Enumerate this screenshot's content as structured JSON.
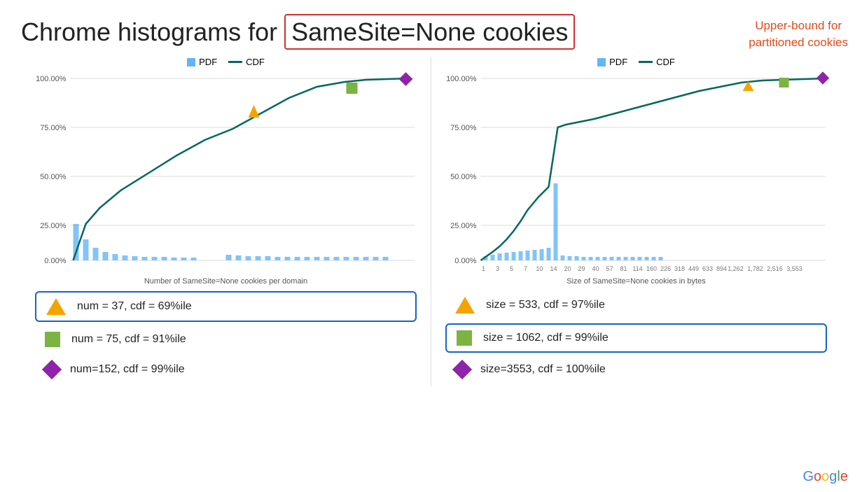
{
  "page": {
    "title_prefix": "Chrome histograms for ",
    "title_highlight": "SameSite=None cookies",
    "upper_bound_line1": "Upper-bound for",
    "upper_bound_line2": "partitioned cookies"
  },
  "left_chart": {
    "legend_pdf": "PDF",
    "legend_cdf": "CDF",
    "subtitle": "Number of SameSite=None cookies per domain",
    "y_labels": [
      "100.00%",
      "75.00%",
      "50.00%",
      "25.00%",
      "0.00%"
    ],
    "annotations": [
      {
        "id": "orange-triangle",
        "text": "num = 37, cdf = 69%ile",
        "highlighted": true
      },
      {
        "id": "green-square",
        "text": "num = 75, cdf = 91%ile",
        "highlighted": false
      },
      {
        "id": "purple-diamond",
        "text": "num=152, cdf = 99%ile",
        "highlighted": false
      }
    ]
  },
  "right_chart": {
    "legend_pdf": "PDF",
    "legend_cdf": "CDF",
    "subtitle": "Size of SameSite=None cookies in bytes",
    "y_labels": [
      "100.00%",
      "75.00%",
      "50.00%",
      "25.00%",
      "0.00%"
    ],
    "x_labels": [
      "1",
      "3",
      "5",
      "7",
      "10",
      "14",
      "20",
      "29",
      "40",
      "57",
      "81",
      "114",
      "160",
      "226",
      "318",
      "449",
      "633",
      "894",
      "1,262",
      "1,782",
      "2,516",
      "3,553"
    ],
    "annotations": [
      {
        "id": "orange-triangle",
        "text": "size = 533, cdf = 97%ile",
        "highlighted": false
      },
      {
        "id": "green-square",
        "text": "size = 1062, cdf = 99%ile",
        "highlighted": true
      },
      {
        "id": "purple-diamond",
        "text": "size=3553, cdf = 100%ile",
        "highlighted": false
      }
    ]
  },
  "google": "Google"
}
